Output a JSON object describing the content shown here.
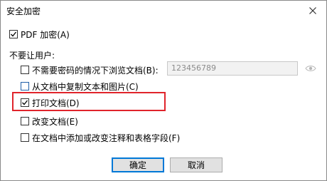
{
  "dialog": {
    "title": "安全加密",
    "close_icon": "close-icon"
  },
  "pdf_encrypt": {
    "label": "PDF 加密(A)",
    "checked": true
  },
  "section": {
    "label": "不要让用户:"
  },
  "options": [
    {
      "label": "不需要密码的情况下浏览文档(B):",
      "checked": false
    },
    {
      "label": "从文档中复制文本和图片(C)",
      "checked": false
    },
    {
      "label": "打印文档(D)",
      "checked": true
    },
    {
      "label": "改变文档(E)",
      "checked": false
    },
    {
      "label": "在文档中添加或改变注释和表格字段(F)",
      "checked": false
    }
  ],
  "password": {
    "value": "123456789",
    "reveal_icon": "eye-icon"
  },
  "buttons": {
    "ok_label": "确定",
    "cancel_label": "取消"
  },
  "colors": {
    "highlight": "#e0242b",
    "default_button_border": "#0078d7"
  }
}
